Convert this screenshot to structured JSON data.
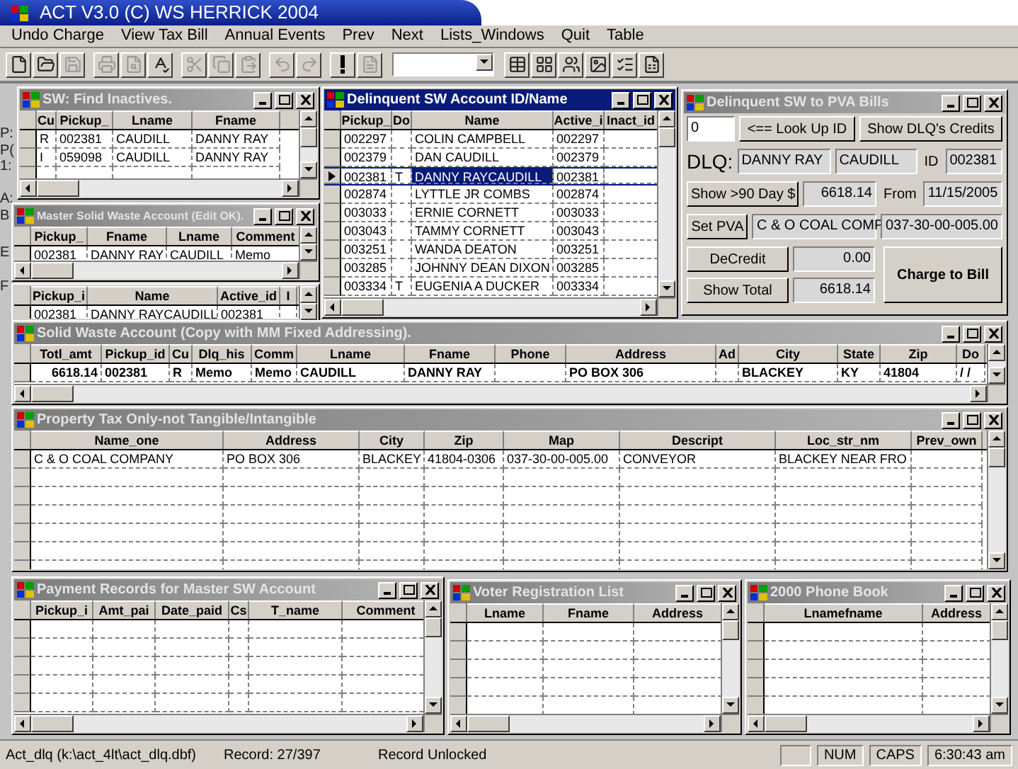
{
  "app_title": "ACT V3.0 (C) WS HERRICK 2004",
  "menu": [
    "Undo Charge",
    "View Tax Bill",
    "Annual Events",
    "Prev",
    "Next",
    "Lists_Windows",
    "Quit",
    "Table"
  ],
  "toolbar": [
    {
      "disabled": false
    },
    {
      "disabled": false
    },
    {
      "disabled": true
    },
    {
      "disabled": true
    },
    {
      "disabled": true
    },
    {
      "disabled": false
    },
    {
      "disabled": true
    },
    {
      "disabled": true
    },
    {
      "disabled": true
    },
    {
      "disabled": true
    },
    {
      "disabled": true
    },
    {
      "disabled": false
    },
    {
      "disabled": true
    },
    {
      "disabled": false
    },
    {
      "disabled": false
    },
    {
      "disabled": false
    },
    {
      "disabled": false
    },
    {
      "disabled": false
    },
    {
      "disabled": false
    }
  ],
  "background_labels": [
    "P:",
    "P(",
    "1:",
    "A:",
    "B",
    "E",
    "F"
  ],
  "windows": [
    {
      "kind": "grid",
      "title": "SW: Find Inactives.",
      "active": false,
      "columns": [
        "Cu",
        "Pickup_",
        "Lname",
        "Fname"
      ],
      "rows": [
        {
          "cells": [
            "R",
            "002381",
            "CAUDILL",
            "DANNY RAY"
          ],
          "selected": false
        },
        {
          "cells": [
            "I",
            "059098",
            "CAUDILL",
            "DANNY RAY"
          ],
          "selected": false
        }
      ]
    },
    {
      "kind": "grid",
      "title": "Master Solid Waste Account (Edit OK).",
      "active": false,
      "columns": [
        "Pickup_",
        "Fname",
        "Lname",
        "Comment"
      ],
      "rows": [
        {
          "cells": [
            "002381",
            "DANNY RAY",
            "CAUDILL",
            "Memo"
          ],
          "selected": false
        }
      ]
    },
    {
      "kind": "grid",
      "columns": [
        "Pickup_i",
        "Name",
        "Active_id",
        "I"
      ],
      "rows": [
        {
          "cells": [
            "002381",
            "DANNY RAYCAUDILL",
            "002381",
            ""
          ],
          "selected": false
        }
      ]
    },
    {
      "kind": "grid",
      "title": "Delinquent SW Account ID/Name",
      "active": true,
      "columns": [
        "Pickup_",
        "Do",
        "Name",
        "Active_i",
        "Inact_id"
      ],
      "rows": [
        {
          "cells": [
            "002297",
            "",
            "COLIN CAMPBELL",
            "002297",
            ""
          ],
          "selected": false
        },
        {
          "cells": [
            "002379",
            "",
            "DAN CAUDILL",
            "002379",
            ""
          ],
          "selected": false
        },
        {
          "cells": [
            "002381",
            "T",
            "DANNY RAYCAUDILL",
            "002381",
            ""
          ],
          "selected": true
        },
        {
          "cells": [
            "002874",
            "",
            "LYTTLE JR COMBS",
            "002874",
            ""
          ],
          "selected": false
        },
        {
          "cells": [
            "003033",
            "",
            "ERNIE CORNETT",
            "003033",
            ""
          ],
          "selected": false
        },
        {
          "cells": [
            "003043",
            "",
            "TAMMY CORNETT",
            "003043",
            ""
          ],
          "selected": false
        },
        {
          "cells": [
            "003251",
            "",
            "WANDA DEATON",
            "003251",
            ""
          ],
          "selected": false
        },
        {
          "cells": [
            "003285",
            "",
            "JOHNNY DEAN DIXON",
            "003285",
            ""
          ],
          "selected": false
        },
        {
          "cells": [
            "003334",
            "T",
            "EUGENIA A DUCKER",
            "003334",
            ""
          ],
          "selected": false
        }
      ]
    },
    {
      "kind": "form",
      "title": "Delinquent SW to PVA Bills",
      "active": false,
      "form": {
        "lookup_value": "0",
        "lookup_button": "<== Look Up ID",
        "credits_button": "Show DLQ's Credits",
        "dlq_label": "DLQ:",
        "first_name": "DANNY RAY",
        "last_name": "CAUDILL",
        "id_label": "ID",
        "id": "002381",
        "overdue_button": "Show >90 Day $",
        "overdue_amount": "6618.14",
        "from_label": "From",
        "from_date": "11/15/2005",
        "pva_button": "Set PVA",
        "pva_owner": "C & O COAL COMP",
        "pva_map": "037-30-00-005.00",
        "decredit_button": "DeCredit",
        "decredit_amount": "0.00",
        "total_button": "Show Total",
        "total_amount": "6618.14",
        "charge_button": "Charge to Bill"
      }
    },
    {
      "kind": "grid",
      "title": "Solid Waste  Account  (Copy with MM Fixed Addressing).",
      "active": false,
      "columns": [
        "Totl_amt",
        "Pickup_id",
        "Cu",
        "Dlq_his",
        "Comm",
        "Lname",
        "Fname",
        "Phone",
        "Address",
        "Ad",
        "City",
        "State",
        "Zip",
        "Do"
      ],
      "rows": [
        {
          "cells": [
            "6618.14",
            "002381",
            "R",
            "Memo",
            "Memo",
            "CAUDILL",
            "DANNY RAY",
            "",
            "PO BOX 306",
            "",
            "BLACKEY",
            "KY",
            "41804",
            "/  /"
          ],
          "selected": false
        }
      ]
    },
    {
      "kind": "grid",
      "title": "Property Tax Only-not Tangible/Intangible",
      "active": false,
      "columns": [
        "Name_one",
        "Address",
        "City",
        "Zip",
        "Map",
        "Descript",
        "Loc_str_nm",
        "Prev_own"
      ],
      "rows": [
        {
          "cells": [
            "C & O COAL COMPANY",
            "PO BOX 306",
            "BLACKEY",
            "41804-0306",
            "037-30-00-005.00",
            "CONVEYOR",
            "BLACKEY NEAR FRO",
            ""
          ],
          "selected": false
        }
      ]
    },
    {
      "kind": "grid",
      "title": "Payment Records for Master SW Account",
      "active": false,
      "columns": [
        "Pickup_i",
        "Amt_pai",
        "Date_paid",
        "Cs",
        "T_name",
        "Comment"
      ]
    },
    {
      "kind": "grid",
      "title": "Voter Registration List",
      "active": false,
      "columns": [
        "Lname",
        "Fname",
        "Address"
      ]
    },
    {
      "kind": "grid",
      "title": "2000 Phone Book",
      "active": false,
      "columns": [
        "Lnamefname",
        "Address"
      ]
    }
  ],
  "status_bar": {
    "file": "Act_dlq (k:\\act_4lt\\act_dlq.dbf)",
    "record": "Record: 27/397",
    "lock": "Record Unlocked",
    "num": "NUM",
    "caps": "CAPS",
    "time": "6:30:43 am"
  }
}
